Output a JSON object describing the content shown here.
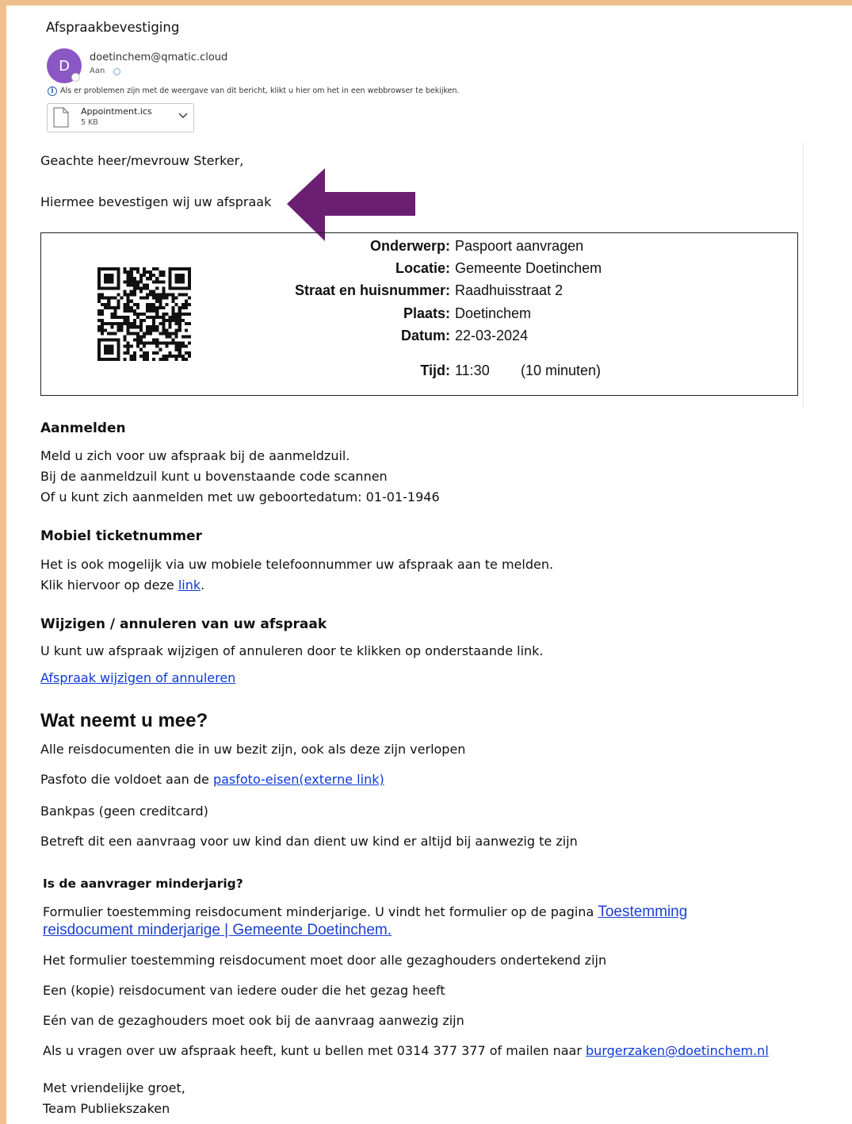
{
  "header": {
    "subject": "Afspraakbevestiging",
    "avatar_letter": "D",
    "sender": "doetinchem@qmatic.cloud",
    "to_label": "Aan",
    "info_text": "Als er problemen zijn met de weergave van dit bericht, klikt u hier om het in een webbrowser te bekijken."
  },
  "attachment": {
    "name": "Appointment.ics",
    "size": "5 KB"
  },
  "body": {
    "greeting": "Geachte heer/mevrouw Sterker,",
    "confirmation": "Hiermee bevestigen wij uw afspraak"
  },
  "appointment": {
    "subject_label": "Onderwerp:",
    "subject_value": "Paspoort aanvragen",
    "location_label": "Locatie:",
    "location_value": "Gemeente Doetinchem",
    "street_label": "Straat en huisnummer:",
    "street_value": "Raadhuisstraat 2",
    "place_label": "Plaats:",
    "place_value": "Doetinchem",
    "date_label": "Datum:",
    "date_value": "22-03-2024",
    "time_label": "Tijd:",
    "time_value": "11:30",
    "duration": "(10 minuten)"
  },
  "checkin": {
    "heading": "Aanmelden",
    "line1": "Meld u zich voor uw afspraak bij de aanmeldzuil.",
    "line2": "Bij de aanmeldzuil kunt u bovenstaande code scannen",
    "line3": "Of u kunt zich aanmelden met uw geboortedatum: 01-01-1946"
  },
  "mobile": {
    "heading": "Mobiel ticketnummer",
    "line1": "Het is ook mogelijk via uw mobiele telefoonnummer uw afspraak aan te melden.",
    "line2_prefix": "Klik hiervoor op deze ",
    "link": "link",
    "line2_suffix": "."
  },
  "change": {
    "heading": "Wijzigen / annuleren van uw afspraak",
    "line1": "U kunt uw afspraak wijzigen of annuleren door te klikken op onderstaande link.",
    "link": "Afspraak wijzigen of annuleren"
  },
  "bring": {
    "heading": "Wat neemt u mee?",
    "line1": "Alle reisdocumenten die in uw bezit zijn, ook als deze zijn verlopen",
    "line2_prefix": "Pasfoto die voldoet aan de ",
    "line2_link": "pasfoto-eisen(externe link)",
    "line3": "Bankpas (geen creditcard)",
    "line4": "Betreft dit een aanvraag voor uw kind dan dient uw kind er altijd bij aanwezig te zijn"
  },
  "minor": {
    "heading": "Is de aanvrager minderjarig?",
    "line1_prefix": "Formulier toestemming reisdocument minderjarige. U vindt het formulier op de pagina ",
    "link_part1": "Toestemming",
    "link_part2": "reisdocument minderjarige | Gemeente Doetinchem.",
    "line2": "Het formulier toestemming reisdocument moet door alle gezaghouders ondertekend zijn",
    "line3": "Een (kopie) reisdocument van iedere ouder die het gezag heeft",
    "line4": "Eén van de gezaghouders moet ook bij de aanvraag aanwezig zijn",
    "line5_prefix": "Als u vragen over uw afspraak heeft, kunt u bellen met 0314 377 377 of mailen naar ",
    "email": "burgerzaken@doetinchem.nl"
  },
  "closing": {
    "line1": "Met vriendelijke groet,",
    "line2": "Team Publiekszaken"
  },
  "colors": {
    "frame": "#efc08e",
    "avatar": "#8a57c4",
    "arrow": "#6b1f72",
    "link": "#0b3ad6"
  },
  "icons": [
    "info-icon",
    "file-icon",
    "chevron-down-icon",
    "qr-code",
    "arrow-annotation"
  ]
}
